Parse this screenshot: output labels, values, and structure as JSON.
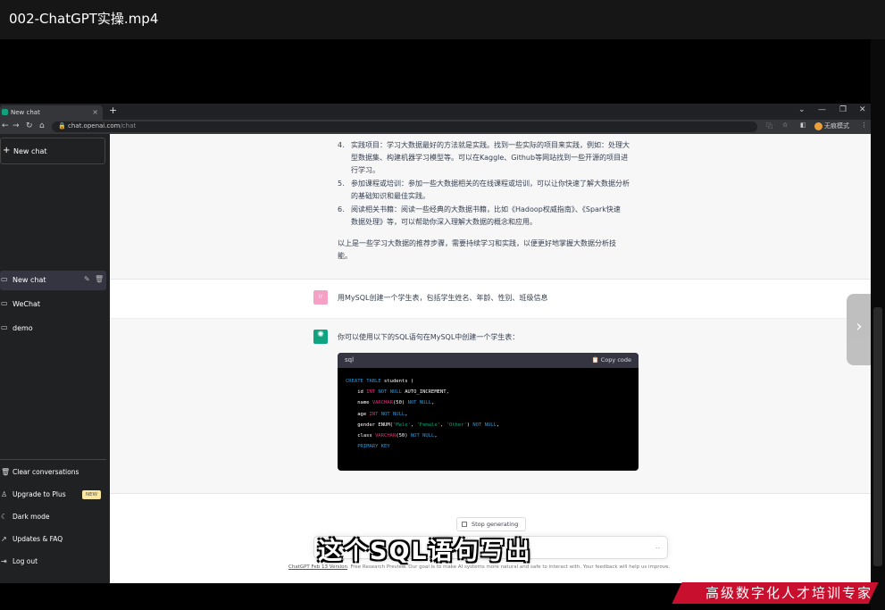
{
  "player": {
    "title": "002-ChatGPT实操.mp4"
  },
  "browser": {
    "tab_title": "New chat",
    "new_tab": "+",
    "url_host": "chat.openai.com",
    "url_path": "/chat",
    "profile_label": "无痕模式"
  },
  "sidebar": {
    "new_chat": "New chat",
    "chats": [
      "New chat",
      "WeChat",
      "demo"
    ],
    "bottom": {
      "clear": "Clear conversations",
      "upgrade": "Upgrade to Plus",
      "upgrade_badge": "NEW",
      "dark": "Dark mode",
      "updates": "Updates & FAQ",
      "logout": "Log out"
    }
  },
  "answer1": {
    "items": [
      {
        "num": "4.",
        "lines": [
          "实践项目：学习大数据最好的方法就是实践。找到一些实际的项目来实践，例如：处理大",
          "型数据集、构建机器学习模型等。可以在Kaggle、Github等网站找到一些开源的项目进",
          "行学习。"
        ]
      },
      {
        "num": "5.",
        "lines": [
          "参加课程或培训：参加一些大数据相关的在线课程或培训，可以让你快速了解大数据分析",
          "的基础知识和最佳实践。"
        ]
      },
      {
        "num": "6.",
        "lines": [
          "阅读相关书籍：阅读一些经典的大数据书籍，比如《Hadoop权威指南》、《Spark快速",
          "数据处理》等，可以帮助你深入理解大数据的概念和应用。"
        ]
      }
    ],
    "summary": [
      "以上是一些学习大数据的推荐步骤，需要持续学习和实践，以便更好地掌握大数据分析技",
      "能。"
    ]
  },
  "question2": {
    "avatar_text": "Ir",
    "text": "用MySQL创建一个学生表，包括学生姓名、年龄、性别、班级信息"
  },
  "answer2": {
    "text": "你可以使用以下的SQL语句在MySQL中创建一个学生表：",
    "code_lang": "sql",
    "copy_label": "Copy code",
    "code_lines": [
      "CREATE TABLE students (",
      "    id INT NOT NULL AUTO_INCREMENT,",
      "    name VARCHAR(50) NOT NULL,",
      "    age INT NOT NULL,",
      "    gender ENUM('Male', 'Female', 'Other') NOT NULL,",
      "    class VARCHAR(50) NOT NULL,",
      "    PRIMARY KEY"
    ]
  },
  "stop_label": "Stop generating",
  "input_hint": "..",
  "footer": {
    "link": "ChatGPT Feb 13 Version",
    "text": ". Free Research Preview. Our goal is to make AI systems more natural and safe to interact with. Your feedback will help us improve."
  },
  "subtitle": "这个SQL语句写出",
  "watermark": "高级数字化人才培训专家"
}
